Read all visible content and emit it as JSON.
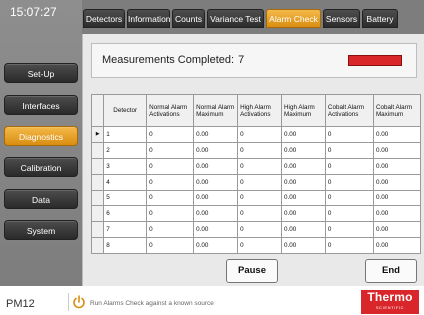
{
  "clock": "15:07:27",
  "nav": {
    "setup": "Set-Up",
    "interfaces": "Interfaces",
    "diagnostics": "Diagnostics",
    "calibration": "Calibration",
    "data": "Data",
    "system": "System"
  },
  "tabs": {
    "detectors": "Detectors",
    "information": "Information",
    "counts": "Counts",
    "variance": "Variance Test",
    "alarm": "Alarm Check",
    "sensors": "Sensors",
    "battery": "Battery"
  },
  "measurement": {
    "label": "Measurements Completed:",
    "count": "7",
    "status_color": "#d8262b"
  },
  "table": {
    "headers": {
      "detector": "Detector",
      "normal_act": "Normal Alarm Activations",
      "normal_max": "Normal Alarm Maximum",
      "high_act": "High Alarm Activations",
      "high_max": "High Alarm Maximum",
      "cobalt_act": "Cobalt Alarm Activations",
      "cobalt_max": "Cobalt Alarm Maximum"
    },
    "rows": [
      {
        "detector": "1",
        "normal_act": "0",
        "normal_max": "0.00",
        "high_act": "0",
        "high_max": "0.00",
        "cobalt_act": "0",
        "cobalt_max": "0.00"
      },
      {
        "detector": "2",
        "normal_act": "0",
        "normal_max": "0.00",
        "high_act": "0",
        "high_max": "0.00",
        "cobalt_act": "0",
        "cobalt_max": "0.00"
      },
      {
        "detector": "3",
        "normal_act": "0",
        "normal_max": "0.00",
        "high_act": "0",
        "high_max": "0.00",
        "cobalt_act": "0",
        "cobalt_max": "0.00"
      },
      {
        "detector": "4",
        "normal_act": "0",
        "normal_max": "0.00",
        "high_act": "0",
        "high_max": "0.00",
        "cobalt_act": "0",
        "cobalt_max": "0.00"
      },
      {
        "detector": "5",
        "normal_act": "0",
        "normal_max": "0.00",
        "high_act": "0",
        "high_max": "0.00",
        "cobalt_act": "0",
        "cobalt_max": "0.00"
      },
      {
        "detector": "6",
        "normal_act": "0",
        "normal_max": "0.00",
        "high_act": "0",
        "high_max": "0.00",
        "cobalt_act": "0",
        "cobalt_max": "0.00"
      },
      {
        "detector": "7",
        "normal_act": "0",
        "normal_max": "0.00",
        "high_act": "0",
        "high_max": "0.00",
        "cobalt_act": "0",
        "cobalt_max": "0.00"
      },
      {
        "detector": "8",
        "normal_act": "0",
        "normal_max": "0.00",
        "high_act": "0",
        "high_max": "0.00",
        "cobalt_act": "0",
        "cobalt_max": "0.00"
      }
    ]
  },
  "buttons": {
    "pause": "Pause",
    "end": "End"
  },
  "footer": {
    "model": "PM12",
    "hint": "Run Alarms Check against a known source",
    "logo_main": "Thermo",
    "logo_sub": "SCIENTIFIC"
  },
  "colors": {
    "accent": "#e8a020",
    "alarm_red": "#d8262b",
    "rail": "#7d7d7d"
  }
}
